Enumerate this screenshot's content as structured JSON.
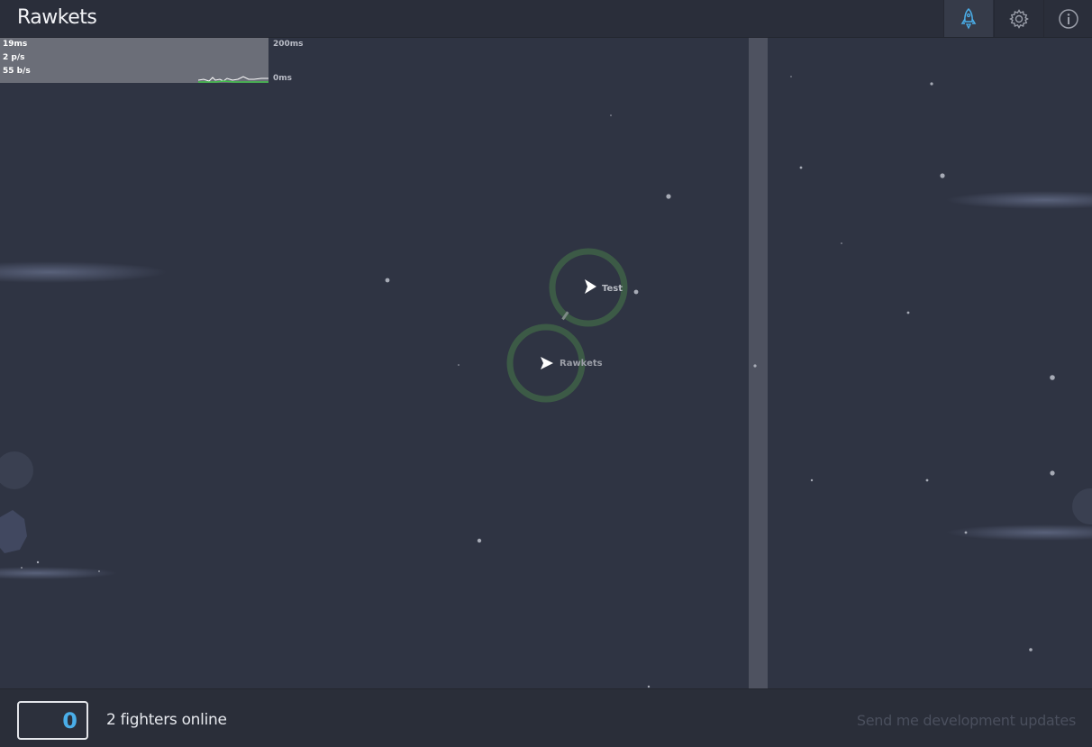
{
  "header": {
    "title": "Rawkets",
    "buttons": [
      {
        "icon": "rocket-icon",
        "active": true
      },
      {
        "icon": "gear-icon",
        "active": false
      },
      {
        "icon": "info-icon",
        "active": false
      }
    ],
    "accent_color": "#4aaee9"
  },
  "stats": {
    "latency": "19ms",
    "packets": "2 p/s",
    "bandwidth": "55 b/s",
    "graph_max": "200ms",
    "graph_min": "0ms"
  },
  "game": {
    "players": [
      {
        "name": "Test"
      },
      {
        "name": "Rawkets"
      }
    ],
    "shield_color": "#3c5a46"
  },
  "footer": {
    "score": "0",
    "online_text": "2 fighters online",
    "updates_link": "Send me development updates"
  }
}
